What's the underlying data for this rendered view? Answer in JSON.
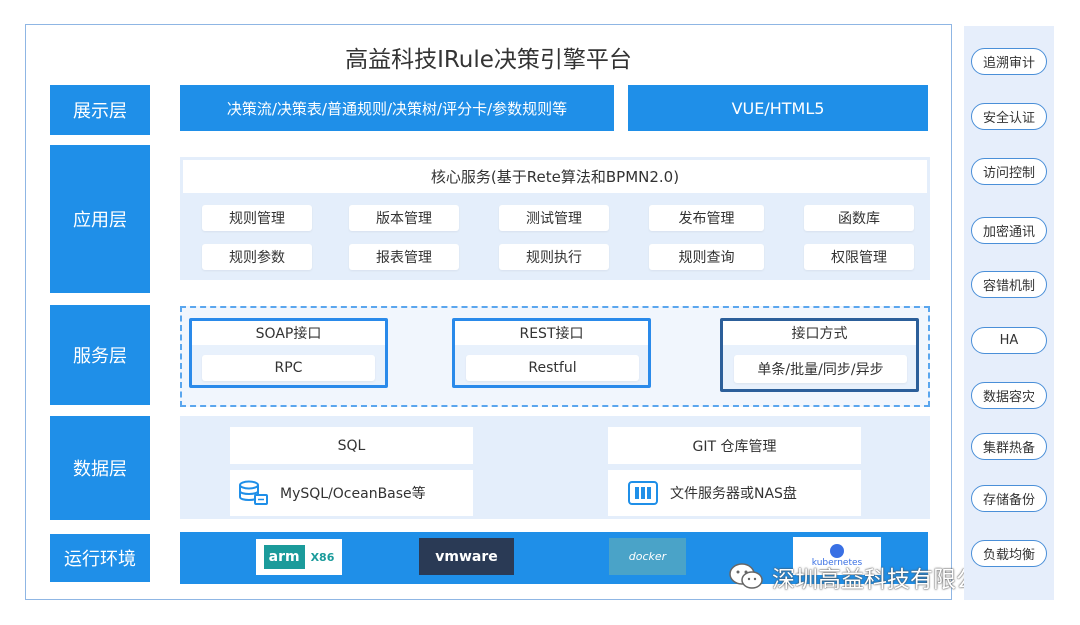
{
  "title": "高益科技IRule决策引擎平台",
  "layers": {
    "display": "展示层",
    "application": "应用层",
    "service": "服务层",
    "data": "数据层",
    "runtime": "运行环境"
  },
  "display_row": {
    "left": "决策流/决策表/普通规则/决策树/评分卡/参数规则等",
    "right": "VUE/HTML5"
  },
  "application": {
    "core": "核心服务(基于Rete算法和BPMN2.0)",
    "row1": [
      "规则管理",
      "版本管理",
      "测试管理",
      "发布管理",
      "函数库"
    ],
    "row2": [
      "规则参数",
      "报表管理",
      "规则执行",
      "规则查询",
      "权限管理"
    ]
  },
  "service": {
    "soap": {
      "title": "SOAP接口",
      "item": "RPC"
    },
    "rest": {
      "title": "REST接口",
      "item": "Restful"
    },
    "mode": {
      "title": "接口方式",
      "item": "单条/批量/同步/异步"
    }
  },
  "data": {
    "sql": "SQL",
    "mysql": "MySQL/OceanBase等",
    "git": "GIT 仓库管理",
    "file": "文件服务器或NAS盘"
  },
  "runtime": {
    "arm": "arm",
    "x86": "X86",
    "vmware": "vmware",
    "docker": "docker",
    "k8s": "kubernetes"
  },
  "side_tags": [
    "追溯审计",
    "安全认证",
    "访问控制",
    "加密通讯",
    "容错机制",
    "HA",
    "数据容灾",
    "集群热备",
    "存储备份",
    "负载均衡"
  ],
  "watermark": "深圳高益科技有限公司",
  "colors": {
    "accent": "#1f8fe8",
    "panel": "#e4eefb",
    "border": "#8fb6e4"
  }
}
